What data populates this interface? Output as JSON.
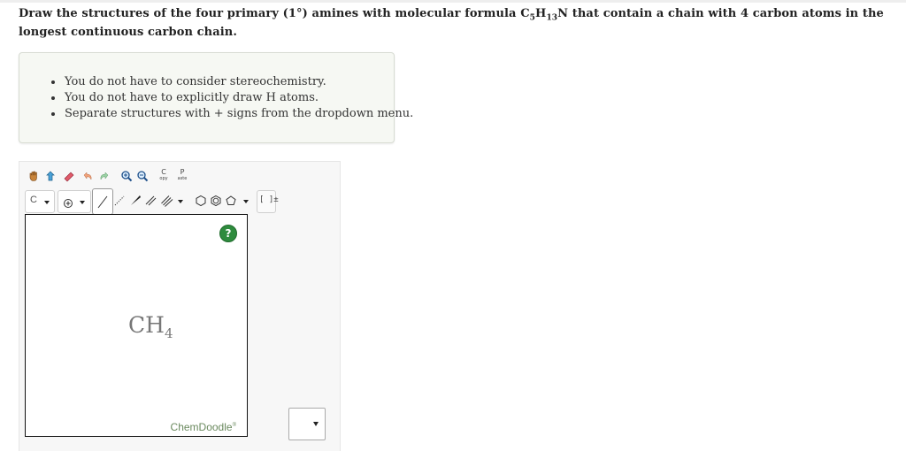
{
  "question": {
    "part1": "Draw the structures of the four primary (1°) amines with molecular formula C",
    "sub1": "5",
    "part2": "H",
    "sub2": "13",
    "part3": "N that contain a chain with 4 carbon atoms in the longest continuous carbon chain."
  },
  "notes": [
    "You do not have to consider stereochemistry.",
    "You do not have to explicitly draw H atoms.",
    "Separate structures with + signs from the dropdown menu."
  ],
  "toolbar": {
    "row1": [
      {
        "icon": "hand-icon"
      },
      {
        "icon": "clear-icon"
      },
      {
        "icon": "eraser-icon"
      },
      {
        "icon": "undo-icon"
      },
      {
        "icon": "redo-icon"
      },
      {
        "icon": "zoom-in-icon"
      },
      {
        "icon": "zoom-out-icon"
      },
      {
        "icon": "copy-icon",
        "top": "C",
        "bottom": "opy"
      },
      {
        "icon": "paste-icon",
        "top": "P",
        "bottom": "aste"
      }
    ],
    "element_label": "C",
    "charge_icon": "plus-circle-icon",
    "bond_icons": [
      "single-bond-icon",
      "dashed-bond-icon",
      "wedge-bond-icon",
      "double-bond-icon",
      "triple-bond-icon"
    ],
    "ring_icons": [
      "cyclohexane-icon",
      "benzene-icon",
      "cyclopentane-icon"
    ],
    "bracket_label": "[ ]±"
  },
  "canvas": {
    "molecule_main": "CH",
    "molecule_sub": "4",
    "help_label": "?",
    "brand": "ChemDoodle",
    "brand_mark": "®"
  },
  "dropdown": {
    "selected": ""
  }
}
